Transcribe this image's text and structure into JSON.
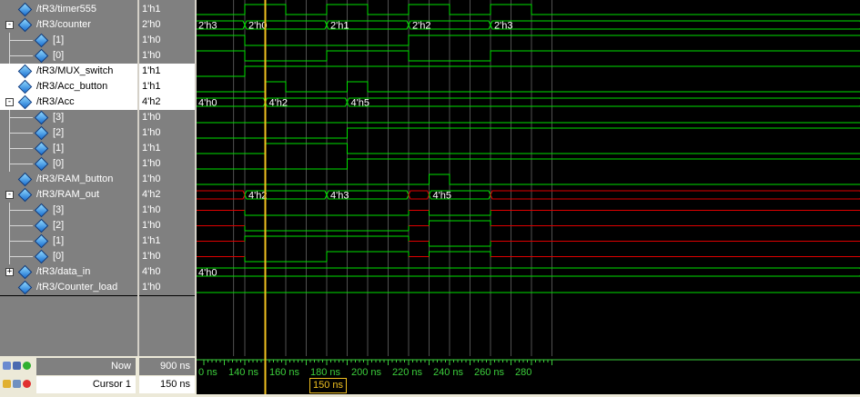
{
  "signals": [
    {
      "name": "/tR3/timer555",
      "value": "1'h1",
      "expand": "",
      "depth": 0
    },
    {
      "name": "/tR3/counter",
      "value": "2'h0",
      "expand": "-",
      "depth": 0
    },
    {
      "name": "[1]",
      "value": "1'h0",
      "expand": "",
      "depth": 1
    },
    {
      "name": "[0]",
      "value": "1'h0",
      "expand": "",
      "depth": 1
    },
    {
      "name": "/tR3/MUX_switch",
      "value": "1'h1",
      "expand": "",
      "depth": 0,
      "selected": true
    },
    {
      "name": "/tR3/Acc_button",
      "value": "1'h1",
      "expand": "",
      "depth": 0,
      "selected": true
    },
    {
      "name": "/tR3/Acc",
      "value": "4'h2",
      "expand": "-",
      "depth": 0,
      "selected": true
    },
    {
      "name": "[3]",
      "value": "1'h0",
      "expand": "",
      "depth": 1
    },
    {
      "name": "[2]",
      "value": "1'h0",
      "expand": "",
      "depth": 1
    },
    {
      "name": "[1]",
      "value": "1'h1",
      "expand": "",
      "depth": 1
    },
    {
      "name": "[0]",
      "value": "1'h0",
      "expand": "",
      "depth": 1
    },
    {
      "name": "/tR3/RAM_button",
      "value": "1'h0",
      "expand": "",
      "depth": 0
    },
    {
      "name": "/tR3/RAM_out",
      "value": "4'h2",
      "expand": "-",
      "depth": 0
    },
    {
      "name": "[3]",
      "value": "1'h0",
      "expand": "",
      "depth": 1
    },
    {
      "name": "[2]",
      "value": "1'h0",
      "expand": "",
      "depth": 1
    },
    {
      "name": "[1]",
      "value": "1'h1",
      "expand": "",
      "depth": 1
    },
    {
      "name": "[0]",
      "value": "1'h0",
      "expand": "",
      "depth": 1
    },
    {
      "name": "/tR3/data_in",
      "value": "4'h0",
      "expand": "+",
      "depth": 0
    },
    {
      "name": "/tR3/Counter_load",
      "value": "1'h0",
      "expand": "",
      "depth": 0
    }
  ],
  "bus_labels": {
    "counter": [
      "2'h3",
      "2'h0",
      "2'h1",
      "2'h2",
      "2'h3"
    ],
    "acc": [
      "4'h0",
      "4'h2",
      "4'h5"
    ],
    "ram_out": [
      "4'h2",
      "4'h3",
      "4'h5"
    ],
    "data_in": [
      "4'h0"
    ]
  },
  "status": {
    "now_label": "Now",
    "now_value": "900 ns",
    "cursor_label": "Cursor 1",
    "cursor_value": "150 ns",
    "cursor_marker": "150 ns"
  },
  "timeline": {
    "ticks": [
      "0 ns",
      "140 ns",
      "160 ns",
      "180 ns",
      "200 ns",
      "220 ns",
      "240 ns",
      "260 ns",
      "280"
    ]
  },
  "colors": {
    "signal": "#00e000",
    "undefined": "#e00000",
    "cursor": "#f0c020",
    "background": "#000000"
  }
}
